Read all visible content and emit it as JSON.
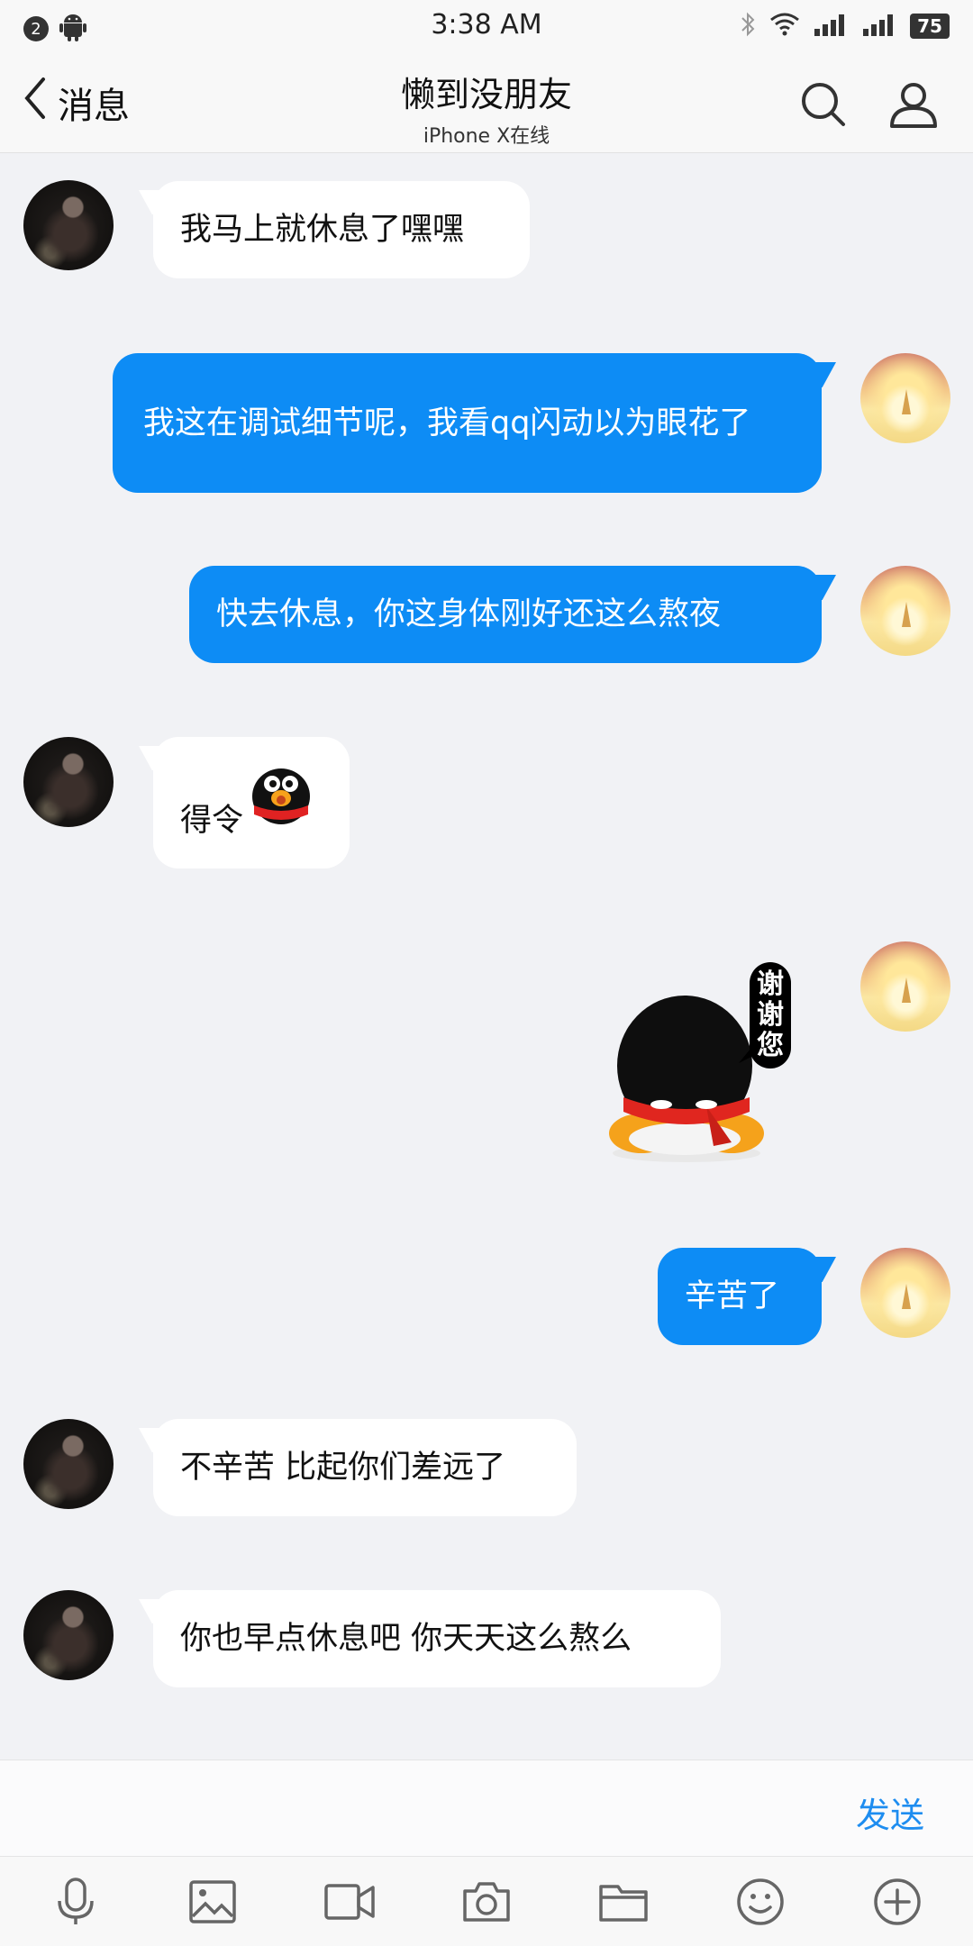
{
  "status_bar": {
    "notification_count": "2",
    "time": "3:38 AM",
    "battery": "75"
  },
  "header": {
    "back_label": "消息",
    "title": "懒到没朋友",
    "subtitle": "iPhone X在线"
  },
  "messages": [
    {
      "side": "in",
      "text": "我马上就休息了嘿嘿"
    },
    {
      "side": "out",
      "text": "我这在调试细节呢，我看qq闪动以为眼花了"
    },
    {
      "side": "out",
      "text": "快去休息，你这身体刚好还这么熬夜"
    },
    {
      "side": "in",
      "text": "得令"
    },
    {
      "side": "out",
      "type": "sticker",
      "sticker_text": "谢谢您"
    },
    {
      "side": "out",
      "text": "辛苦了"
    },
    {
      "side": "in",
      "text": "不辛苦 比起你们差远了"
    },
    {
      "side": "in",
      "text": "你也早点休息吧 你天天这么熬么"
    }
  ],
  "input": {
    "value": "",
    "send_label": "发送"
  },
  "toolbar": {
    "items": [
      "microphone-icon",
      "image-icon",
      "video-icon",
      "camera-icon",
      "folder-icon",
      "emoji-icon",
      "plus-icon"
    ]
  },
  "colors": {
    "outgoing_bubble": "#0d8cf5",
    "incoming_bubble": "#ffffff",
    "background": "#f1f2f5",
    "send_text": "#1e8df0"
  }
}
